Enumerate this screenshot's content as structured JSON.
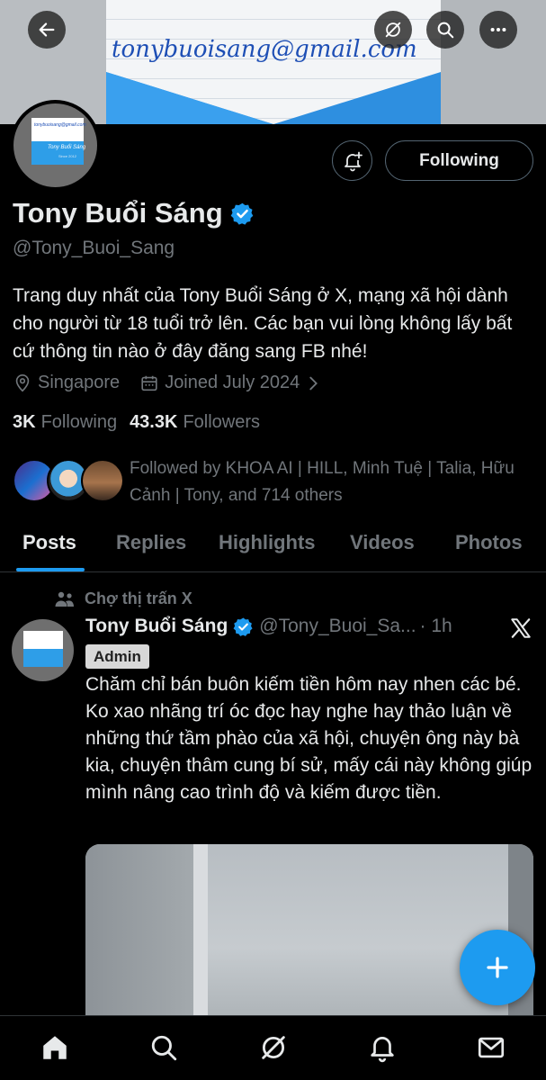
{
  "banner": {
    "email_text": "tonybuoisang@gmail.com"
  },
  "header": {
    "back_icon": "arrow-left-icon",
    "grok_icon": "grok-icon",
    "search_icon": "search-icon",
    "more_icon": "more-horizontal-icon"
  },
  "avatar": {
    "card_text": "tonybuoisang@gmail.com",
    "card_name": "Tony Buổi Sáng",
    "card_sub": "Since 2012"
  },
  "actions": {
    "notify_icon": "bell-plus-icon",
    "following_label": "Following"
  },
  "profile": {
    "name": "Tony Buổi Sáng",
    "handle": "@Tony_Buoi_Sang",
    "bio": "Trang duy nhất của Tony Buổi Sáng ở X, mạng xã hội dành cho người từ 18 tuổi trở lên. Các bạn vui lòng không lấy bất cứ thông tin nào ở đây đăng sang FB nhé!",
    "location": "Singapore",
    "joined": "Joined July 2024",
    "following_count": "3K",
    "following_label": "Following",
    "followers_count": "43.3K",
    "followers_label": "Followers",
    "followed_by": "Followed by KHOA AI | HILL, Minh Tuệ | Talia, Hữu Cảnh | Tony, and 714 others"
  },
  "tabs": [
    {
      "label": "Posts"
    },
    {
      "label": "Replies"
    },
    {
      "label": "Highlights"
    },
    {
      "label": "Videos"
    },
    {
      "label": "Photos"
    }
  ],
  "post": {
    "community": "Chợ thị trấn X",
    "author_name": "Tony Buổi Sáng",
    "author_handle": "@Tony_Buoi_Sa...",
    "time": "· 1h",
    "badge": "Admin",
    "text": "Chăm chỉ bán buôn kiếm tiền hôm nay nhen các bé. Ko xao nhãng trí óc đọc hay nghe hay thảo luận về những thứ tầm phào của xã hội, chuyện ông này bà kia, chuyện thâm cung bí sử, mấy cái này không giúp mình nâng cao trình độ và kiếm được tiền."
  },
  "fab_icon": "plus-icon",
  "bottom_nav": [
    "home-icon",
    "search-icon",
    "grok-icon",
    "notifications-icon",
    "messages-icon"
  ],
  "colors": {
    "accent": "#1d9bf0",
    "muted": "#71767b",
    "background": "#000000",
    "text": "#e7e9ea"
  }
}
